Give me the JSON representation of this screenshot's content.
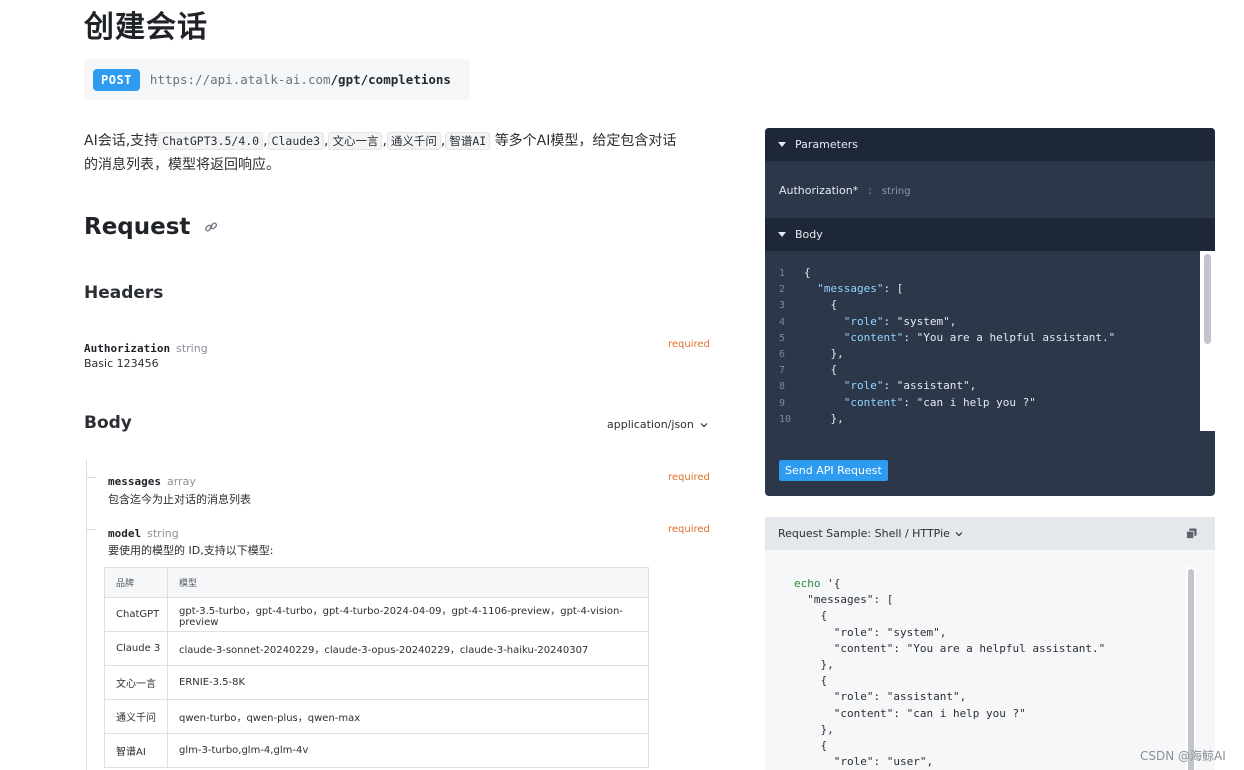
{
  "page": {
    "title": "创建会话",
    "method": "POST",
    "url_base": "https://api.atalk-ai.com",
    "url_path": "/gpt/completions",
    "description": {
      "prefix": "AI会话,支持",
      "models": [
        "ChatGPT3.5/4.0",
        "Claude3",
        "文心一言",
        "通义千问",
        "智谱AI"
      ],
      "separator": ",",
      "suffix": "等多个AI模型，给定包含对话",
      "line2": "的消息列表，模型将返回响应。"
    }
  },
  "request": {
    "heading": "Request",
    "headers_heading": "Headers",
    "auth": {
      "name": "Authorization",
      "type": "string",
      "required": "required",
      "value": "Basic 123456"
    },
    "body_heading": "Body",
    "content_type": "application/json",
    "fields": [
      {
        "name": "messages",
        "type": "array",
        "required": "required",
        "description": "包含迄今为止对话的消息列表"
      },
      {
        "name": "model",
        "type": "string",
        "required": "required",
        "description": "要使用的模型的 ID,支持以下模型:"
      }
    ],
    "model_table": {
      "headers": [
        "品牌",
        "模型"
      ],
      "rows": [
        [
          "ChatGPT",
          "gpt-3.5-turbo，gpt-4-turbo，gpt-4-turbo-2024-04-09，gpt-4-1106-preview，gpt-4-vision-preview"
        ],
        [
          "Claude 3",
          "claude-3-sonnet-20240229，claude-3-opus-20240229，claude-3-haiku-20240307"
        ],
        [
          "文心一言",
          "ERNIE-3.5-8K"
        ],
        [
          "通义千问",
          "qwen-turbo，qwen-plus，qwen-max"
        ],
        [
          "智谱AI",
          "glm-3-turbo,glm-4,glm-4v"
        ]
      ]
    }
  },
  "console": {
    "parameters_label": "Parameters",
    "auth_param": "Authorization*",
    "auth_sep": ":",
    "auth_type": "string",
    "body_label": "Body",
    "code_lines": [
      {
        "n": "1",
        "text": "{"
      },
      {
        "n": "2",
        "text": "  \"messages\": ["
      },
      {
        "n": "3",
        "text": "    {"
      },
      {
        "n": "4",
        "text": "      \"role\": \"system\","
      },
      {
        "n": "5",
        "text": "      \"content\": \"You are a helpful assistant.\""
      },
      {
        "n": "6",
        "text": "    },"
      },
      {
        "n": "7",
        "text": "    {"
      },
      {
        "n": "8",
        "text": "      \"role\": \"assistant\","
      },
      {
        "n": "9",
        "text": "      \"content\": \"can i help you ?\""
      },
      {
        "n": "10",
        "text": "    },"
      }
    ],
    "send_button": "Send API Request"
  },
  "sample": {
    "label": "Request Sample: Shell / HTTPie",
    "cmd": "echo",
    "code_rest": " '{\n  \"messages\": [\n    {\n      \"role\": \"system\",\n      \"content\": \"You are a helpful assistant.\"\n    },\n    {\n      \"role\": \"assistant\",\n      \"content\": \"can i help you ?\"\n    },\n    {\n      \"role\": \"user\","
  },
  "watermark": "CSDN @海鲸AI"
}
